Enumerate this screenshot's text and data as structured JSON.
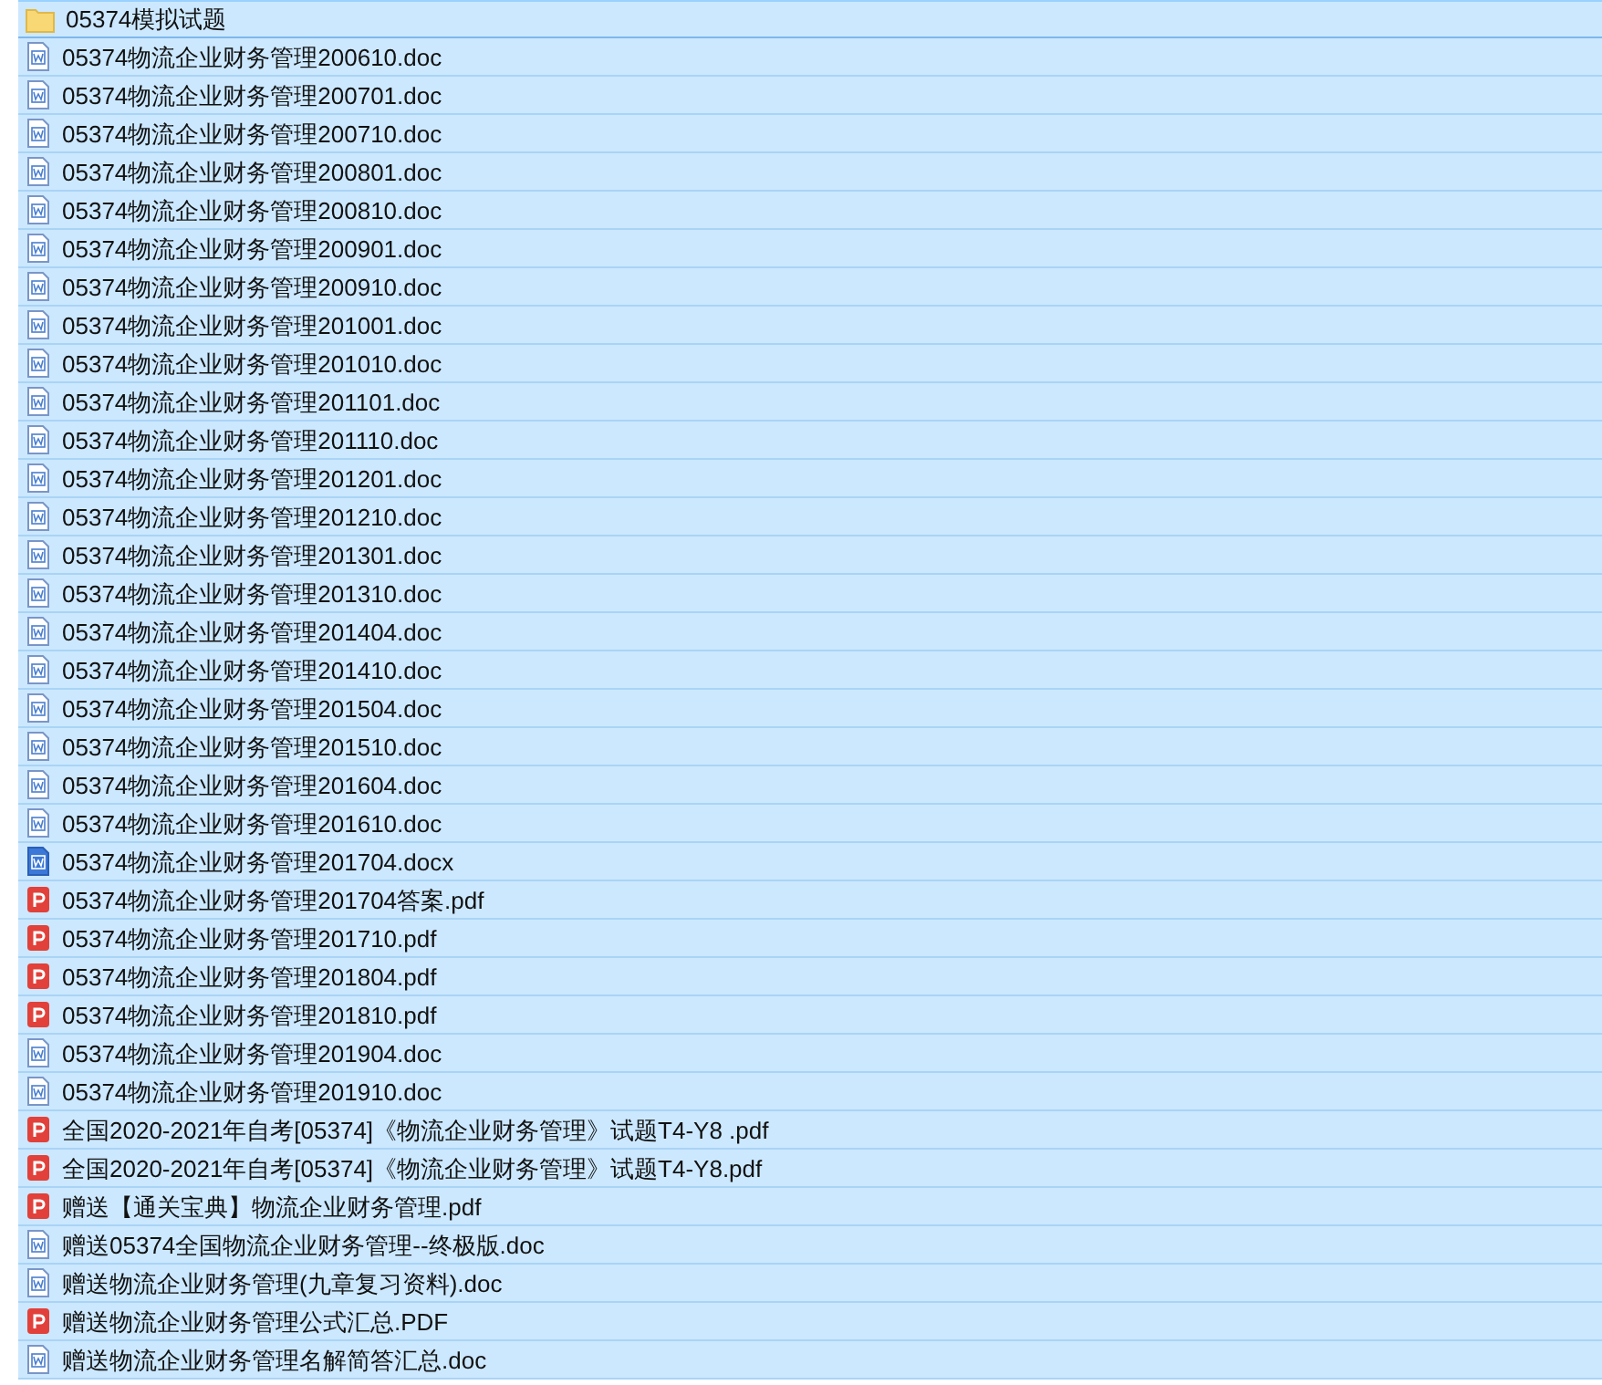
{
  "files": [
    {
      "name": "05374模拟试题",
      "kind": "folder",
      "selected": true,
      "focused": true
    },
    {
      "name": "05374物流企业财务管理200610.doc",
      "kind": "doc",
      "selected": true,
      "focused": false
    },
    {
      "name": "05374物流企业财务管理200701.doc",
      "kind": "doc",
      "selected": true,
      "focused": false
    },
    {
      "name": "05374物流企业财务管理200710.doc",
      "kind": "doc",
      "selected": true,
      "focused": false
    },
    {
      "name": "05374物流企业财务管理200801.doc",
      "kind": "doc",
      "selected": true,
      "focused": false
    },
    {
      "name": "05374物流企业财务管理200810.doc",
      "kind": "doc",
      "selected": true,
      "focused": false
    },
    {
      "name": "05374物流企业财务管理200901.doc",
      "kind": "doc",
      "selected": true,
      "focused": false
    },
    {
      "name": "05374物流企业财务管理200910.doc",
      "kind": "doc",
      "selected": true,
      "focused": false
    },
    {
      "name": "05374物流企业财务管理201001.doc",
      "kind": "doc",
      "selected": true,
      "focused": false
    },
    {
      "name": "05374物流企业财务管理201010.doc",
      "kind": "doc",
      "selected": true,
      "focused": false
    },
    {
      "name": "05374物流企业财务管理201101.doc",
      "kind": "doc",
      "selected": true,
      "focused": false
    },
    {
      "name": "05374物流企业财务管理201110.doc",
      "kind": "doc",
      "selected": true,
      "focused": false
    },
    {
      "name": "05374物流企业财务管理201201.doc",
      "kind": "doc",
      "selected": true,
      "focused": false
    },
    {
      "name": "05374物流企业财务管理201210.doc",
      "kind": "doc",
      "selected": true,
      "focused": false
    },
    {
      "name": "05374物流企业财务管理201301.doc",
      "kind": "doc",
      "selected": true,
      "focused": false
    },
    {
      "name": "05374物流企业财务管理201310.doc",
      "kind": "doc",
      "selected": true,
      "focused": false
    },
    {
      "name": "05374物流企业财务管理201404.doc",
      "kind": "doc",
      "selected": true,
      "focused": false
    },
    {
      "name": "05374物流企业财务管理201410.doc",
      "kind": "doc",
      "selected": true,
      "focused": false
    },
    {
      "name": "05374物流企业财务管理201504.doc",
      "kind": "doc",
      "selected": true,
      "focused": false
    },
    {
      "name": "05374物流企业财务管理201510.doc",
      "kind": "doc",
      "selected": true,
      "focused": false
    },
    {
      "name": "05374物流企业财务管理201604.doc",
      "kind": "doc",
      "selected": true,
      "focused": false
    },
    {
      "name": "05374物流企业财务管理201610.doc",
      "kind": "doc",
      "selected": true,
      "focused": false
    },
    {
      "name": "05374物流企业财务管理201704.docx",
      "kind": "docx",
      "selected": true,
      "focused": false
    },
    {
      "name": "05374物流企业财务管理201704答案.pdf",
      "kind": "pdf",
      "selected": true,
      "focused": false
    },
    {
      "name": "05374物流企业财务管理201710.pdf",
      "kind": "pdf",
      "selected": true,
      "focused": false
    },
    {
      "name": "05374物流企业财务管理201804.pdf",
      "kind": "pdf",
      "selected": true,
      "focused": false
    },
    {
      "name": "05374物流企业财务管理201810.pdf",
      "kind": "pdf",
      "selected": true,
      "focused": false
    },
    {
      "name": "05374物流企业财务管理201904.doc",
      "kind": "doc",
      "selected": true,
      "focused": false
    },
    {
      "name": "05374物流企业财务管理201910.doc",
      "kind": "doc",
      "selected": true,
      "focused": false
    },
    {
      "name": "全国2020-2021年自考[05374]《物流企业财务管理》试题T4-Y8 .pdf",
      "kind": "pdf",
      "selected": true,
      "focused": false
    },
    {
      "name": "全国2020-2021年自考[05374]《物流企业财务管理》试题T4-Y8.pdf",
      "kind": "pdf",
      "selected": true,
      "focused": false
    },
    {
      "name": "赠送【通关宝典】物流企业财务管理.pdf",
      "kind": "pdf",
      "selected": true,
      "focused": false
    },
    {
      "name": "赠送05374全国物流企业财务管理--终极版.doc",
      "kind": "doc",
      "selected": true,
      "focused": false
    },
    {
      "name": "赠送物流企业财务管理(九章复习资料).doc",
      "kind": "doc",
      "selected": true,
      "focused": false
    },
    {
      "name": "赠送物流企业财务管理公式汇总.PDF",
      "kind": "pdf",
      "selected": true,
      "focused": false
    },
    {
      "name": "赠送物流企业财务管理名解简答汇总.doc",
      "kind": "doc",
      "selected": true,
      "focused": false
    }
  ]
}
